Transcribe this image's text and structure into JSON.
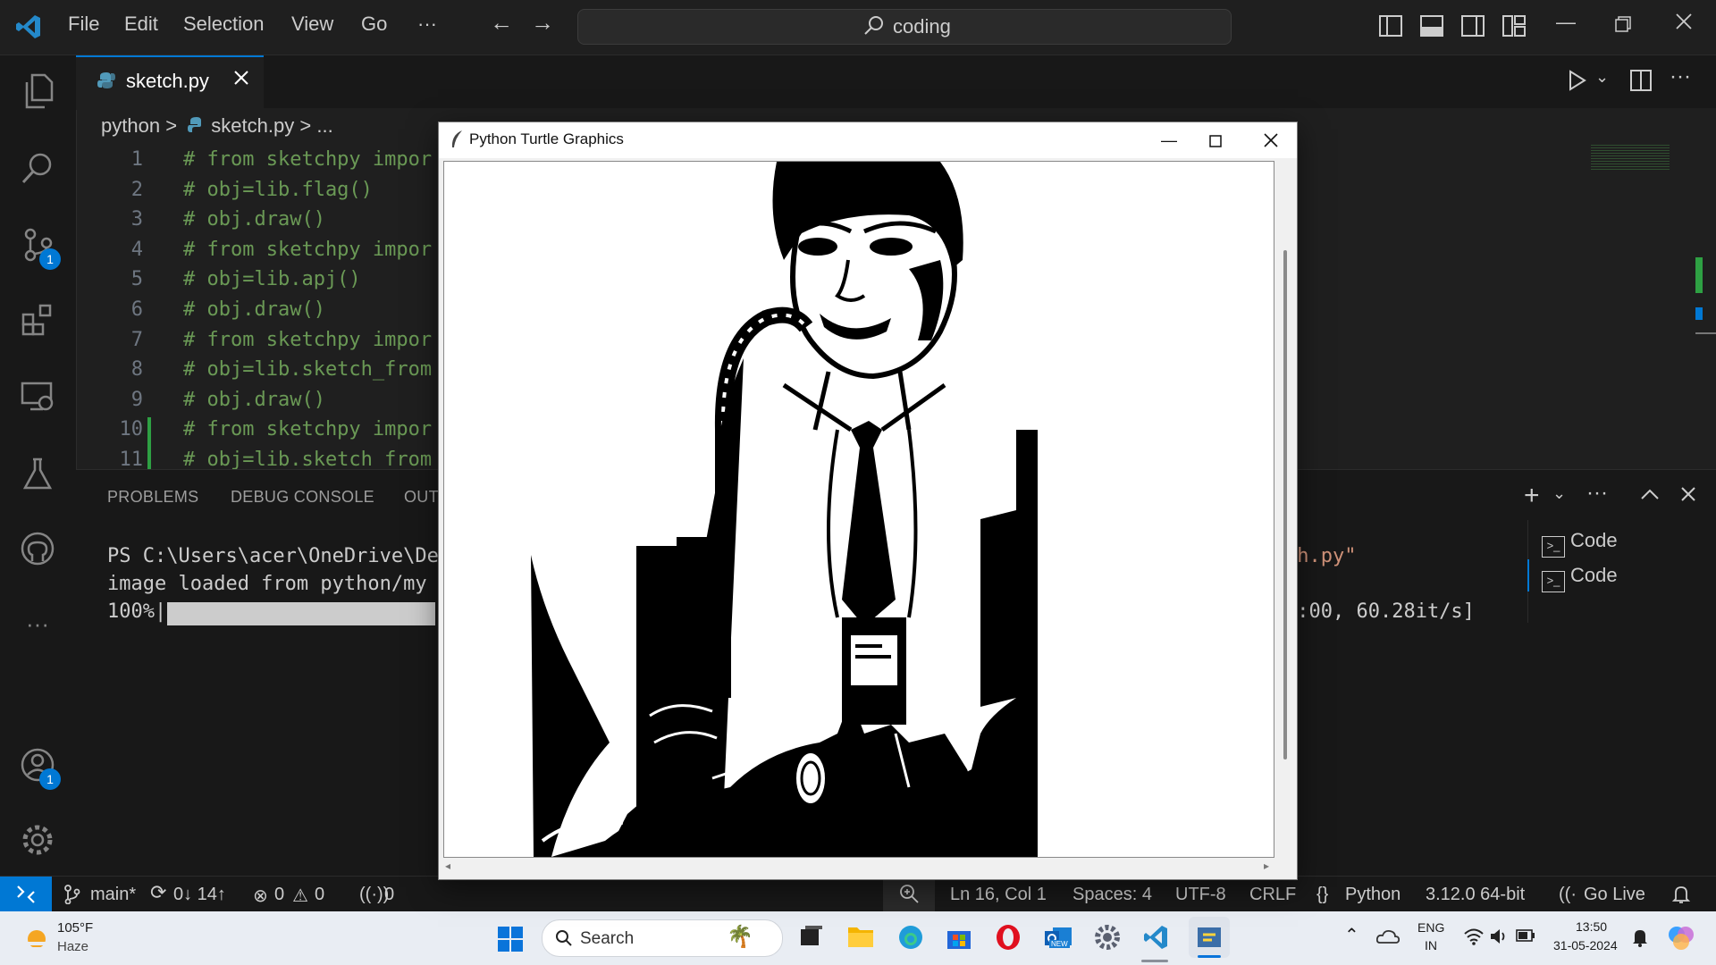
{
  "menu": {
    "file": "File",
    "edit": "Edit",
    "selection": "Selection",
    "view": "View",
    "go": "Go",
    "more": "···"
  },
  "command_center": {
    "text": "coding"
  },
  "activity": {
    "scm_badge": "1",
    "accounts_badge": "1"
  },
  "tab": {
    "filename": "sketch.py"
  },
  "breadcrumb": {
    "folder": "python",
    "sep1": ">",
    "file": "sketch.py",
    "sep2": ">",
    "tail": "..."
  },
  "code_lines": [
    {
      "num": "1",
      "text": "# from sketchpy impor"
    },
    {
      "num": "2",
      "text": "# obj=lib.flag()"
    },
    {
      "num": "3",
      "text": "# obj.draw()"
    },
    {
      "num": "4",
      "text": "# from sketchpy impor"
    },
    {
      "num": "5",
      "text": "# obj=lib.apj()"
    },
    {
      "num": "6",
      "text": "# obj.draw()"
    },
    {
      "num": "7",
      "text": "# from sketchpy impor"
    },
    {
      "num": "8",
      "text": "# obj=lib.sketch_from"
    },
    {
      "num": "9",
      "text": "# obj.draw()"
    },
    {
      "num": "10",
      "text": "# from sketchpy impor"
    },
    {
      "num": "11",
      "text": "# obj=lib.sketch from"
    }
  ],
  "panel": {
    "tabs": [
      "PROBLEMS",
      "DEBUG CONSOLE",
      "OUT"
    ],
    "terminal_lines": [
      "PS C:\\Users\\acer\\OneDrive\\Des",
      "image loaded from python/my i",
      "100%|"
    ],
    "terminal_right_1": "ch.py\"",
    "terminal_right_3": "0:00, 60.28it/s]",
    "terminals": [
      "Code",
      "Code"
    ]
  },
  "status": {
    "branch": "main*",
    "sync": "0↓ 14↑",
    "errors": "0",
    "warnings": "0",
    "ports": "0",
    "position": "Ln 16, Col 1",
    "spaces": "Spaces: 4",
    "encoding": "UTF-8",
    "eol": "CRLF",
    "language": "Python",
    "interpreter": "3.12.0 64-bit",
    "golive": "Go Live"
  },
  "turtle_window": {
    "title": "Python Turtle Graphics"
  },
  "taskbar": {
    "weather_temp": "105°F",
    "weather_desc": "Haze",
    "search": "Search",
    "lang1": "ENG",
    "lang2": "IN",
    "time": "13:50",
    "date": "31-05-2024",
    "store_label": "NEW"
  },
  "colors": {
    "accent": "#0078d4",
    "comment": "#6a9955",
    "terminal_string": "#ce9178"
  }
}
